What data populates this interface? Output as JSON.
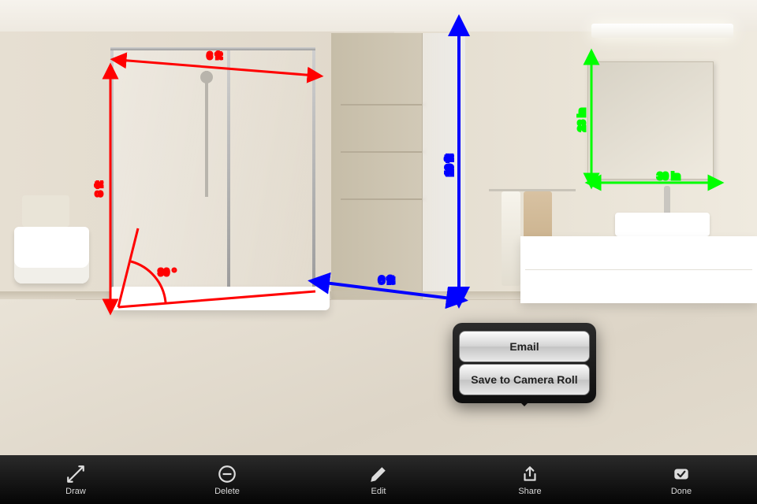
{
  "toolbar": {
    "draw": {
      "label": "Draw"
    },
    "delete": {
      "label": "Delete"
    },
    "edit": {
      "label": "Edit"
    },
    "share": {
      "label": "Share"
    },
    "done": {
      "label": "Done"
    }
  },
  "share_popover": {
    "email": "Email",
    "save": "Save to Camera Roll"
  },
  "measurements": {
    "shower_width": {
      "value": "6 ft",
      "color": "#ff0000"
    },
    "shower_height": {
      "value": "8 ft",
      "color": "#ff0000"
    },
    "shower_angle": {
      "value": "90 °",
      "color": "#ff0000"
    },
    "room_height": {
      "value": "10 ft",
      "color": "#0000ff"
    },
    "room_depth": {
      "value": "6 ft",
      "color": "#0000ff"
    },
    "mirror_height": {
      "value": "23 in",
      "color": "#00ff00"
    },
    "mirror_width": {
      "value": "30 in",
      "color": "#00ff00"
    }
  }
}
